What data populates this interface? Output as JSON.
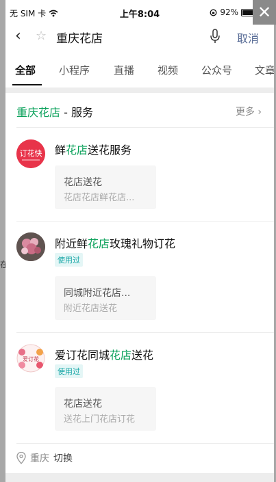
{
  "status_bar": {
    "carrier": "无 SIM 卡",
    "time": "上午8:04",
    "battery": "92%",
    "close_label": "✕"
  },
  "search": {
    "query": "重庆花店",
    "cancel_label": "取消"
  },
  "tabs": [
    "全部",
    "小程序",
    "直播",
    "视频",
    "公众号",
    "文章"
  ],
  "section": {
    "title_highlight": "重庆花店",
    "title_rest": " - 服务",
    "more_label": "更多"
  },
  "items": [
    {
      "logo_text": "订花快",
      "title_pre": "鲜",
      "title_highlight": "花店",
      "title_post": "送花服务",
      "used_badge": "",
      "card_title": "花店送花",
      "card_sub": "花店花店鲜花店..."
    },
    {
      "logo_text": "",
      "title_pre": "附近鲜",
      "title_highlight": "花店",
      "title_post": "玫瑰礼物订花",
      "used_badge": "使用过",
      "card_title": "同城附近花店...",
      "card_sub": "附近花店送花"
    },
    {
      "logo_text": "爱订花",
      "title_pre": "爱订花同城",
      "title_highlight": "花店",
      "title_post": "送花",
      "used_badge": "使用过",
      "card_title": "花店送花",
      "card_sub": "送花上门花店订花"
    }
  ],
  "location": {
    "city": "重庆",
    "switch_label": "切换"
  },
  "colors": {
    "highlight": "#07a058",
    "link": "#576b95",
    "badge": "#17a6a6"
  },
  "edge_text": "在"
}
